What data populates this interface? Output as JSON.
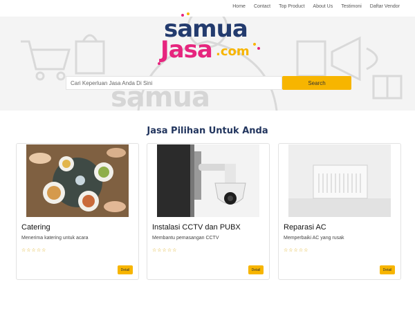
{
  "nav": {
    "items": [
      "Home",
      "Contact",
      "Top Product",
      "About Us",
      "Testimoni",
      "Daftar Vendor"
    ]
  },
  "logo": {
    "line1": "samua",
    "line2": "Jasa",
    "suffix": ".com",
    "colors": {
      "primary": "#233b6e",
      "accent": "#e6257e",
      "suffix": "#f7b500"
    }
  },
  "hero": {
    "watermark": "samua"
  },
  "search": {
    "placeholder": "Cari Keperluan Jasa Anda Di Sini",
    "button_label": "Search"
  },
  "section": {
    "title": "Jasa Pilihan Untuk Anda"
  },
  "cards": [
    {
      "title": "Catering",
      "description": "Menerima katering untuk acara",
      "rating": "☆☆☆☆☆",
      "button_label": "Detail",
      "image": "catering-food-photo"
    },
    {
      "title": "Instalasi CCTV dan PUBX",
      "description": "Membantu pemasangan CCTV",
      "rating": "☆☆☆☆☆",
      "button_label": "Detail",
      "image": "cctv-camera-photo"
    },
    {
      "title": "Reparasi AC",
      "description": "Memperbaiki AC yang rusak",
      "rating": "☆☆☆☆☆",
      "button_label": "Detail",
      "image": "air-conditioner-photo"
    }
  ],
  "colors": {
    "brand_yellow": "#f7b500",
    "title_navy": "#22355e"
  }
}
